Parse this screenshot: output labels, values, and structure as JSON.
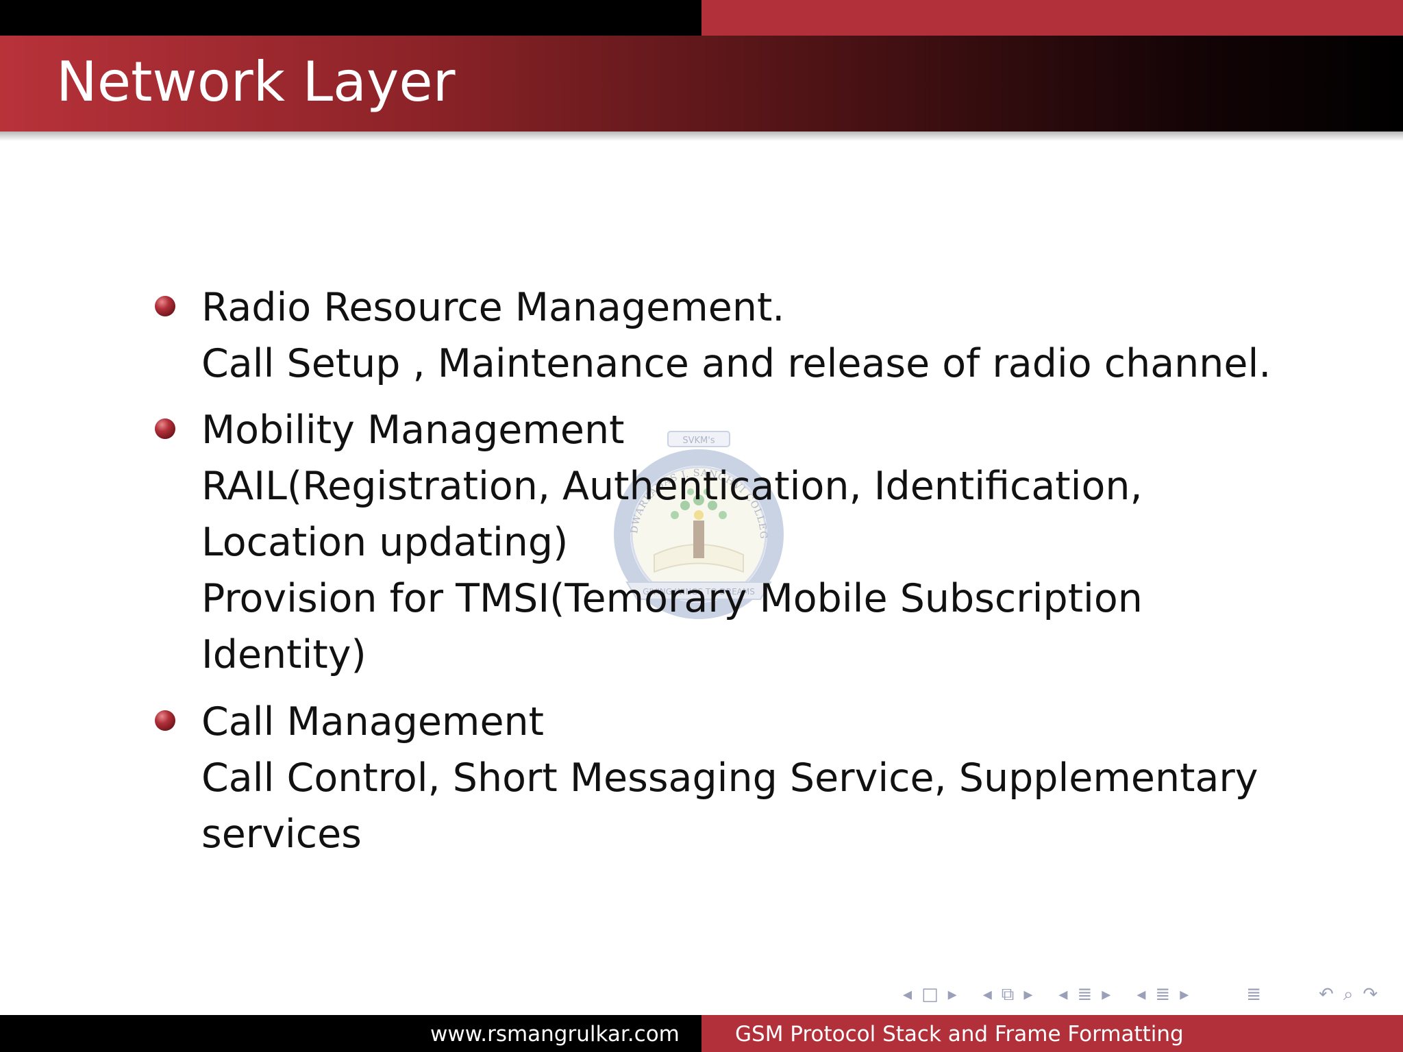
{
  "slide": {
    "title": "Network Layer",
    "bullets": [
      {
        "lines": [
          "Radio Resource Management.",
          "Call Setup , Maintenance and release of radio channel."
        ]
      },
      {
        "lines": [
          "Mobility Management",
          "RAIL(Registration, Authentication, Identification,",
          "Location updating)",
          "Provision for TMSI(Temorary Mobile Subscription",
          "Identity)"
        ]
      },
      {
        "lines": [
          "Call Management",
          "Call Control, Short Messaging Service, Supplementary",
          "services"
        ]
      }
    ]
  },
  "watermark": {
    "org": "SVKM's",
    "ring_text": "DWARKADAS J. SANGHVI COLLEGE OF ENGINEERING",
    "motto": "GIVING WINGS TO DREAMS"
  },
  "footer": {
    "left": "www.rsmangrulkar.com",
    "right": "GSM Protocol Stack and Frame Formatting"
  },
  "navigation": {
    "icons": [
      "nav-prev-frame-icon",
      "nav-frame-icon",
      "nav-next-frame-icon",
      "nav-prev-slide-icon",
      "nav-slide-icon",
      "nav-next-slide-icon",
      "nav-prev-section-icon",
      "nav-section-icon",
      "nav-next-section-icon",
      "nav-prev-subsection-icon",
      "nav-subsection-icon",
      "nav-next-subsection-icon",
      "nav-toc-icon",
      "nav-undo-icon",
      "nav-search-icon",
      "nav-redo-icon"
    ]
  },
  "colors": {
    "accent": "#b2303a",
    "bar_dark": "#000000",
    "text": "#111111"
  }
}
